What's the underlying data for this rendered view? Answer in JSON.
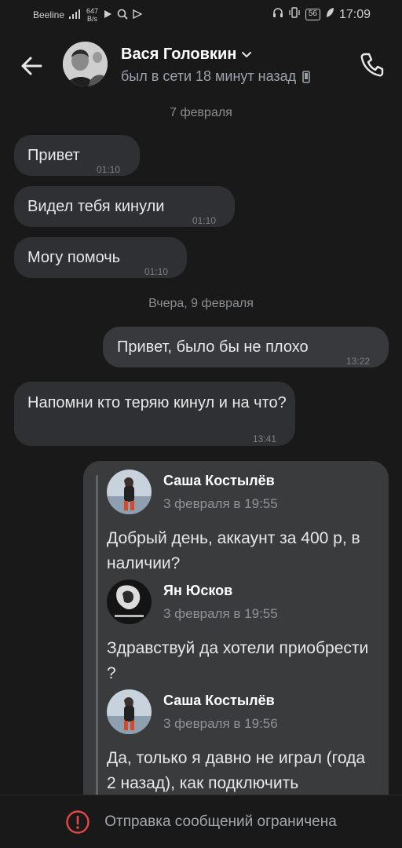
{
  "status_bar": {
    "carrier": "Beeline",
    "speed_value": "647",
    "speed_unit": "B/s",
    "battery": "56",
    "time": "17:09"
  },
  "header": {
    "contact_name": "Вася Головкин",
    "last_seen": "был в сети 18 минут назад"
  },
  "messages": [
    {
      "date": "7 февраля"
    },
    {
      "text": "Привет",
      "time": "01:10"
    },
    {
      "text": "Видел тебя кинули",
      "time": "01:10"
    },
    {
      "text": "Могу помочь",
      "time": "01:10"
    },
    {
      "date": "Вчера, 9 февраля"
    },
    {
      "text": "Привет, было бы не плохо",
      "time": "13:22"
    },
    {
      "text": "Напомни кто теряю кинул и на что?",
      "time": "13:41"
    }
  ],
  "forwarded": [
    {
      "name": "Саша Костылёв",
      "date": "3 февраля в 19:55",
      "text": "Добрый день, аккаунт за 400 р, в наличии?"
    },
    {
      "name": "Ян Юсков",
      "date": "3 февраля в 19:55",
      "text": "Здравствуй да хотели приобрести ?"
    },
    {
      "name": "Саша Костылёв",
      "date": "3 февраля в 19:56",
      "text": "Да, только я давно не играл (года 2 назад), как подключить"
    }
  ],
  "bottom_bar": {
    "notice": "Отправка сообщений ограничена"
  },
  "colors": {
    "background": "#19191a",
    "bubble": "#2f3033",
    "forward_bg": "#3a3b3d",
    "alert_red": "#e64646"
  }
}
